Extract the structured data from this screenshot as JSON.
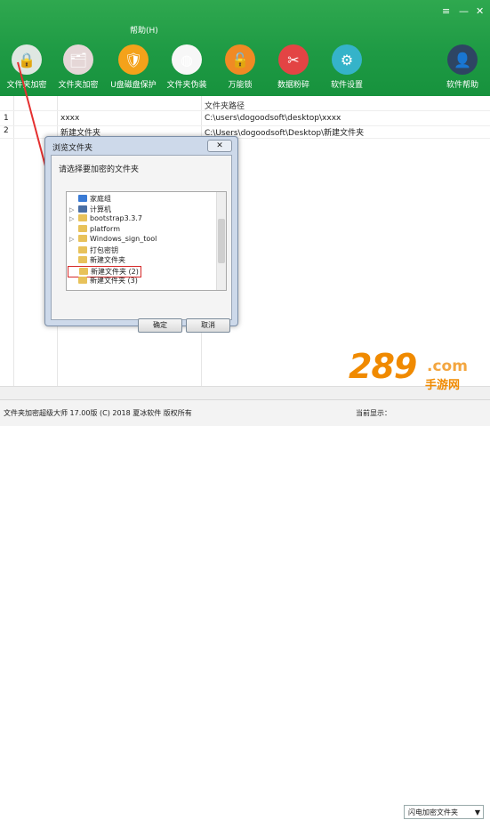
{
  "menu": {
    "help": "帮助(H)"
  },
  "window_controls": {
    "menu": "≡",
    "minimize": "—",
    "close": "✕"
  },
  "toolbar": [
    {
      "label": "文件夹加密",
      "color": "#dfe7e2",
      "glyph": "🔒",
      "icon": "folder-lock-icon"
    },
    {
      "label": "文件夹加密",
      "color": "#e5d7d7",
      "glyph": "🗂",
      "icon": "folder-encrypt-icon"
    },
    {
      "label": "U盘磁盘保护",
      "color": "#f4a21a",
      "glyph": "🛡",
      "icon": "shield-icon"
    },
    {
      "label": "文件夹伪装",
      "color": "#f7f7f7",
      "glyph": "◍",
      "icon": "disguise-icon"
    },
    {
      "label": "万能锁",
      "color": "#f08a24",
      "glyph": "🔓",
      "icon": "lock-icon"
    },
    {
      "label": "数据粉碎",
      "color": "#e34444",
      "glyph": "✂",
      "icon": "shredder-icon"
    },
    {
      "label": "软件设置",
      "color": "#35b3c9",
      "glyph": "⚙",
      "icon": "gear-icon"
    },
    {
      "label": "软件帮助",
      "color": "#2e4563",
      "glyph": "👤",
      "icon": "help-user-icon"
    }
  ],
  "list": {
    "column_path": "文件夹路径",
    "rows": [
      {
        "num": "1",
        "name": "xxxx",
        "path": "C:\\users\\dogoodsoft\\desktop\\xxxx"
      },
      {
        "num": "2",
        "name": "新建文件夹",
        "path": "C:\\Users\\dogoodsoft\\Desktop\\新建文件夹"
      }
    ]
  },
  "dialog": {
    "title": "浏览文件夹",
    "close": "✕",
    "prompt": "请选择要加密的文件夹",
    "tree": [
      {
        "label": "家庭组",
        "arrow": "",
        "indent": 0,
        "icon": "homegroup-icon",
        "color": "#3a7bd5"
      },
      {
        "label": "计算机",
        "arrow": "▷",
        "indent": 0,
        "icon": "computer-icon",
        "color": "#4a6fa5"
      },
      {
        "label": "bootstrap3.3.7",
        "arrow": "▷",
        "indent": 0,
        "icon": "folder-icon",
        "color": "#e8c25a"
      },
      {
        "label": "platform",
        "arrow": "",
        "indent": 0,
        "icon": "folder-icon",
        "color": "#e8c25a"
      },
      {
        "label": "Windows_sign_tool",
        "arrow": "▷",
        "indent": 0,
        "icon": "folder-icon",
        "color": "#e8c25a"
      },
      {
        "label": "打包密钥",
        "arrow": "",
        "indent": 0,
        "icon": "folder-icon",
        "color": "#e8c25a"
      },
      {
        "label": "新建文件夹",
        "arrow": "",
        "indent": 0,
        "icon": "folder-icon",
        "color": "#e8c25a"
      },
      {
        "label": "新建文件夹 (2)",
        "arrow": "",
        "indent": 0,
        "icon": "folder-icon",
        "color": "#e8c25a",
        "highlight": true
      },
      {
        "label": "新建文件夹 (3)",
        "arrow": "",
        "indent": 0,
        "icon": "folder-icon",
        "color": "#e8c25a"
      }
    ],
    "ok": "确定",
    "cancel": "取消"
  },
  "status": {
    "text": "文件夹加密超级大师 17.00版 (C) 2018 夏冰软件 版权所有",
    "display_label": "当前显示：",
    "display_value": "闪电加密文件夹"
  },
  "watermark": {
    "main": "289",
    "com": ".com",
    "sub": "手游网"
  }
}
